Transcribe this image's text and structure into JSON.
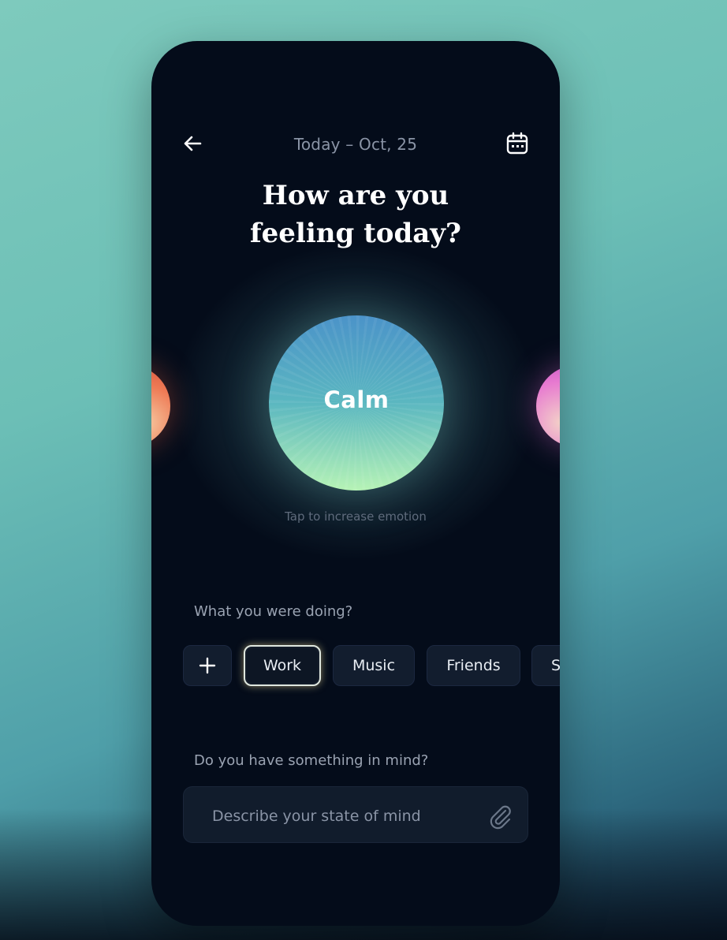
{
  "header": {
    "date_label": "Today – Oct, 25",
    "back_icon": "arrow-left-icon",
    "calendar_icon": "calendar-icon"
  },
  "question": {
    "line1": "How are you",
    "line2": "feeling today?"
  },
  "emotion": {
    "current": "Calm",
    "hint": "Tap to increase emotion",
    "colors": {
      "calm": [
        "#4b93c9",
        "#b6f3b6"
      ],
      "left_neighbor": [
        "#c83b2c",
        "#f6c8a0"
      ],
      "right_neighbor": [
        "#b23fc2",
        "#f3d0c8"
      ]
    }
  },
  "activities": {
    "label": "What you were doing?",
    "add_icon": "plus-icon",
    "chips": [
      {
        "label": "Work",
        "selected": true
      },
      {
        "label": "Music",
        "selected": false
      },
      {
        "label": "Friends",
        "selected": false
      },
      {
        "label": "S",
        "selected": false
      }
    ]
  },
  "notes": {
    "label": "Do you have something in mind?",
    "placeholder": "Describe your state of mind",
    "attach_icon": "paperclip-icon"
  }
}
